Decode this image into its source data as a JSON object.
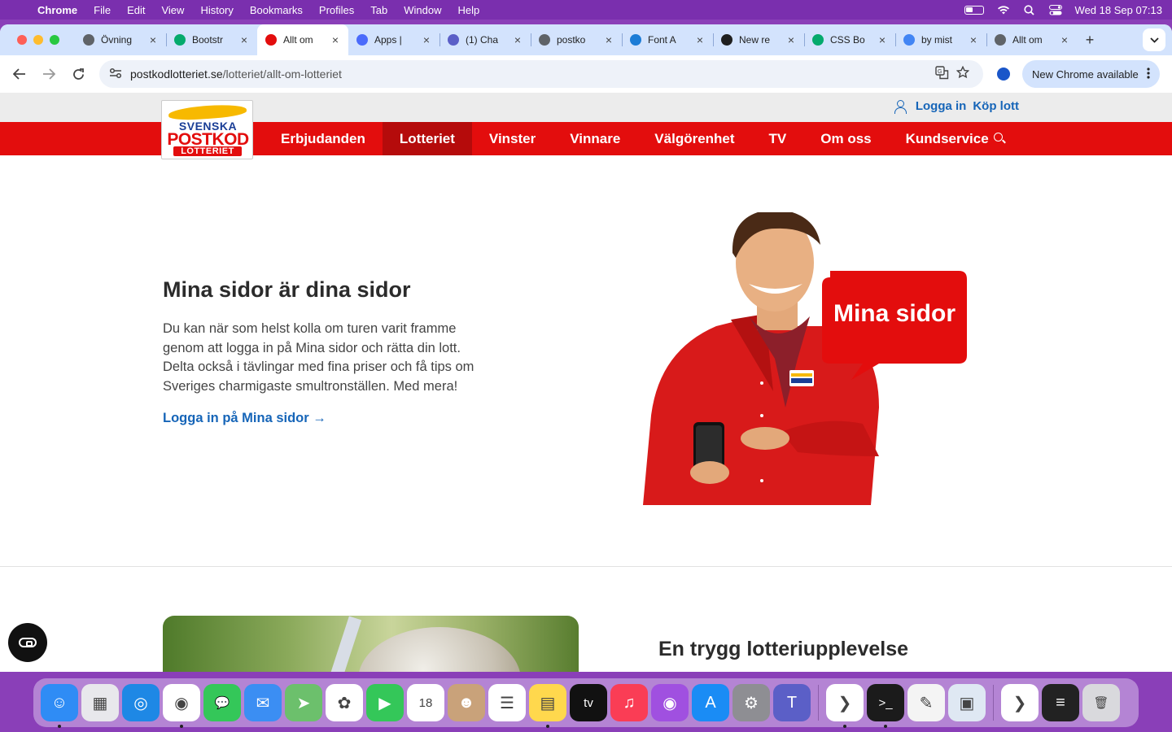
{
  "menubar": {
    "app": "Chrome",
    "items": [
      "File",
      "Edit",
      "View",
      "History",
      "Bookmarks",
      "Profiles",
      "Tab",
      "Window",
      "Help"
    ],
    "datetime": "Wed 18 Sep  07:13"
  },
  "tabs": [
    {
      "title": "Övning",
      "favicon": "globe",
      "color": "#5f6368"
    },
    {
      "title": "Bootstr",
      "favicon": "w3schools",
      "color": "#04aa6d"
    },
    {
      "title": "Allt om",
      "favicon": "postkodlotteriet",
      "color": "#e30d0d",
      "active": true
    },
    {
      "title": "Apps |",
      "favicon": "apps",
      "color": "#4b6bfb"
    },
    {
      "title": "(1) Cha",
      "favicon": "teams",
      "color": "#5b5fc7"
    },
    {
      "title": "postko",
      "favicon": "globe",
      "color": "#5f6368"
    },
    {
      "title": "Font A",
      "favicon": "flag",
      "color": "#1c7cd6"
    },
    {
      "title": "New re",
      "favicon": "github",
      "color": "#1f1f1f"
    },
    {
      "title": "CSS Bo",
      "favicon": "w3schools",
      "color": "#04aa6d"
    },
    {
      "title": "by mist",
      "favicon": "google",
      "color": "#4285f4"
    },
    {
      "title": "Allt om",
      "favicon": "globe",
      "color": "#5f6368"
    }
  ],
  "address": {
    "domain": "postkodlotteriet.se",
    "path": "/lotteriet/allt-om-lotteriet"
  },
  "new_chrome_label": "New Chrome available",
  "site": {
    "logo": {
      "line1": "SVENSKA",
      "line2": "POSTKOD",
      "line3": "LOTTERIET"
    },
    "util": {
      "login": "Logga in",
      "buy": "Köp lott"
    },
    "nav": [
      {
        "label": "Erbjudanden"
      },
      {
        "label": "Lotteriet",
        "active": true
      },
      {
        "label": "Vinster"
      },
      {
        "label": "Vinnare"
      },
      {
        "label": "Välgörenhet"
      },
      {
        "label": "TV"
      },
      {
        "label": "Om oss"
      },
      {
        "label": "Kundservice"
      }
    ],
    "hero": {
      "title": "Mina sidor är dina sidor",
      "text": "Du kan när som helst kolla om turen varit framme genom att logga in på Mina sidor och rätta din lott. Delta också i tävlingar med fina priser och få tips om Sveriges charmigaste smultronställen. Med mera!",
      "link": "Logga in på Mina sidor →",
      "bubble": "Mina sidor"
    },
    "section2": {
      "title": "En trygg lotteriupplevelse"
    }
  },
  "dock": [
    {
      "name": "finder",
      "color": "#2f8cf5",
      "glyph": "☺",
      "running": true
    },
    {
      "name": "launchpad",
      "color": "#e8e8ec",
      "glyph": "▦"
    },
    {
      "name": "safari",
      "color": "#1e88e5",
      "glyph": "◎"
    },
    {
      "name": "chrome",
      "color": "#ffffff",
      "glyph": "◉",
      "running": true
    },
    {
      "name": "messages",
      "color": "#34c759",
      "glyph": "💬"
    },
    {
      "name": "mail",
      "color": "#3b8ef3",
      "glyph": "✉"
    },
    {
      "name": "maps",
      "color": "#6cc06c",
      "glyph": "➤"
    },
    {
      "name": "photos",
      "color": "#ffffff",
      "glyph": "✿"
    },
    {
      "name": "facetime",
      "color": "#34c759",
      "glyph": "▶"
    },
    {
      "name": "calendar",
      "color": "#ffffff",
      "glyph": "18"
    },
    {
      "name": "contacts",
      "color": "#c9a27a",
      "glyph": "☻"
    },
    {
      "name": "reminders",
      "color": "#ffffff",
      "glyph": "☰"
    },
    {
      "name": "notes",
      "color": "#ffd84d",
      "glyph": "▤",
      "running": true
    },
    {
      "name": "apple-tv",
      "color": "#111111",
      "glyph": "tv"
    },
    {
      "name": "music",
      "color": "#fa3d55",
      "glyph": "♫"
    },
    {
      "name": "podcasts",
      "color": "#a050e0",
      "glyph": "◉"
    },
    {
      "name": "app-store",
      "color": "#1a8cf5",
      "glyph": "A"
    },
    {
      "name": "system-settings",
      "color": "#8e8e93",
      "glyph": "⚙"
    },
    {
      "name": "teams",
      "color": "#5b5fc7",
      "glyph": "T"
    },
    {
      "name": "vscode",
      "color": "#ffffff",
      "glyph": "❯",
      "running": true
    },
    {
      "name": "terminal",
      "color": "#1b1b1b",
      "glyph": ">_",
      "running": true
    },
    {
      "name": "textedit",
      "color": "#f4f4f4",
      "glyph": "✎"
    },
    {
      "name": "preview",
      "color": "#dfe8f3",
      "glyph": "▣"
    },
    {
      "name": "vscode-recent",
      "color": "#ffffff",
      "glyph": "❯"
    },
    {
      "name": "terminal-recent",
      "color": "#222222",
      "glyph": "≡"
    },
    {
      "name": "trash",
      "color": "#d9d9dd",
      "glyph": "🗑"
    }
  ]
}
